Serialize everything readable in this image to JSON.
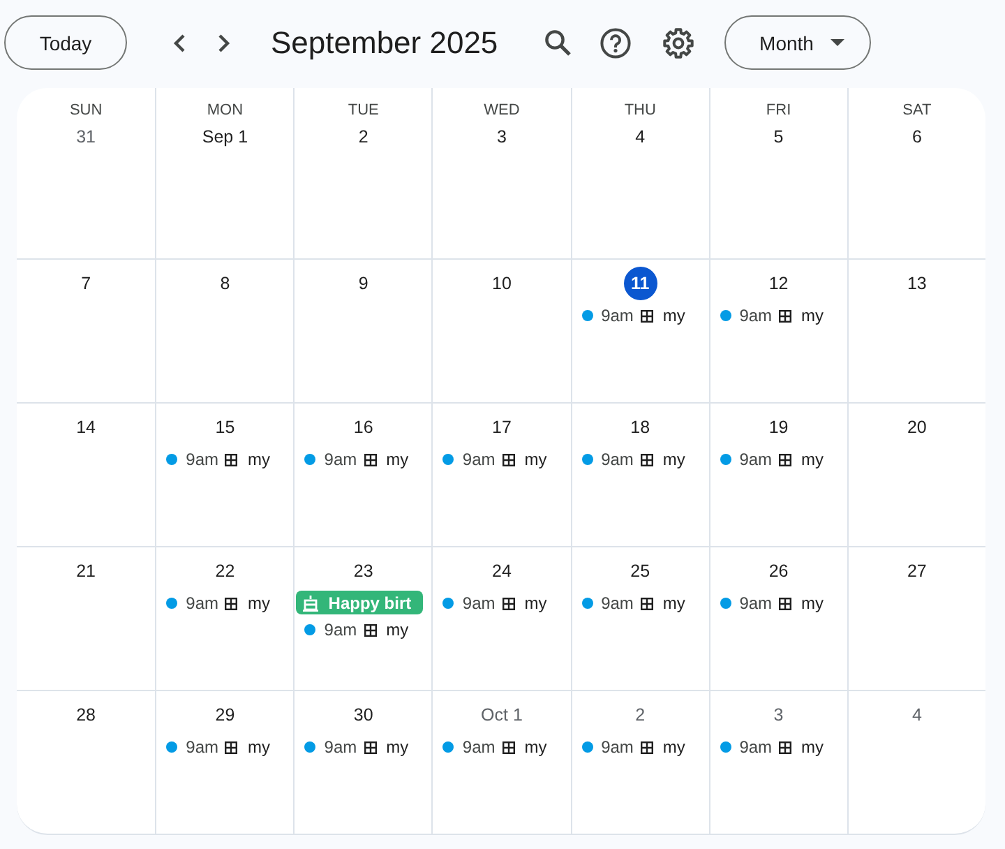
{
  "toolbar": {
    "today_button": "Today",
    "title": "September 2025",
    "view_dropdown": "Month"
  },
  "weekdays": [
    "SUN",
    "MON",
    "TUE",
    "WED",
    "THU",
    "FRI",
    "SAT"
  ],
  "weeks": [
    {
      "days": [
        {
          "date": "31",
          "current_month": false,
          "today": false
        },
        {
          "date": "Sep 1",
          "current_month": true,
          "today": false
        },
        {
          "date": "2",
          "current_month": true,
          "today": false
        },
        {
          "date": "3",
          "current_month": true,
          "today": false
        },
        {
          "date": "4",
          "current_month": true,
          "today": false
        },
        {
          "date": "5",
          "current_month": true,
          "today": false
        },
        {
          "date": "6",
          "current_month": true,
          "today": false
        }
      ]
    },
    {
      "days": [
        {
          "date": "7",
          "current_month": true,
          "today": false
        },
        {
          "date": "8",
          "current_month": true,
          "today": false
        },
        {
          "date": "9",
          "current_month": true,
          "today": false
        },
        {
          "date": "10",
          "current_month": true,
          "today": false
        },
        {
          "date": "11",
          "current_month": true,
          "today": true,
          "events": [
            {
              "kind": "timed",
              "time": "9am",
              "title": "my",
              "color": "#039be5"
            }
          ]
        },
        {
          "date": "12",
          "current_month": true,
          "today": false,
          "events": [
            {
              "kind": "timed",
              "time": "9am",
              "title": "my",
              "color": "#039be5"
            }
          ]
        },
        {
          "date": "13",
          "current_month": true,
          "today": false
        }
      ]
    },
    {
      "days": [
        {
          "date": "14",
          "current_month": true,
          "today": false
        },
        {
          "date": "15",
          "current_month": true,
          "today": false,
          "events": [
            {
              "kind": "timed",
              "time": "9am",
              "title": "my",
              "color": "#039be5"
            }
          ]
        },
        {
          "date": "16",
          "current_month": true,
          "today": false,
          "events": [
            {
              "kind": "timed",
              "time": "9am",
              "title": "my",
              "color": "#039be5"
            }
          ]
        },
        {
          "date": "17",
          "current_month": true,
          "today": false,
          "events": [
            {
              "kind": "timed",
              "time": "9am",
              "title": "my",
              "color": "#039be5"
            }
          ]
        },
        {
          "date": "18",
          "current_month": true,
          "today": false,
          "events": [
            {
              "kind": "timed",
              "time": "9am",
              "title": "my",
              "color": "#039be5"
            }
          ]
        },
        {
          "date": "19",
          "current_month": true,
          "today": false,
          "events": [
            {
              "kind": "timed",
              "time": "9am",
              "title": "my",
              "color": "#039be5"
            }
          ]
        },
        {
          "date": "20",
          "current_month": true,
          "today": false
        }
      ]
    },
    {
      "days": [
        {
          "date": "21",
          "current_month": true,
          "today": false
        },
        {
          "date": "22",
          "current_month": true,
          "today": false,
          "events": [
            {
              "kind": "timed",
              "time": "9am",
              "title": "my",
              "color": "#039be5"
            }
          ]
        },
        {
          "date": "23",
          "current_month": true,
          "today": false,
          "events": [
            {
              "kind": "all_day",
              "title": "Happy birt",
              "color": "#33b679"
            },
            {
              "kind": "timed",
              "time": "9am",
              "title": "my",
              "color": "#039be5"
            }
          ]
        },
        {
          "date": "24",
          "current_month": true,
          "today": false,
          "events": [
            {
              "kind": "timed",
              "time": "9am",
              "title": "my",
              "color": "#039be5"
            }
          ]
        },
        {
          "date": "25",
          "current_month": true,
          "today": false,
          "events": [
            {
              "kind": "timed",
              "time": "9am",
              "title": "my",
              "color": "#039be5"
            }
          ]
        },
        {
          "date": "26",
          "current_month": true,
          "today": false,
          "events": [
            {
              "kind": "timed",
              "time": "9am",
              "title": "my",
              "color": "#039be5"
            }
          ]
        },
        {
          "date": "27",
          "current_month": true,
          "today": false
        }
      ]
    },
    {
      "days": [
        {
          "date": "28",
          "current_month": true,
          "today": false
        },
        {
          "date": "29",
          "current_month": true,
          "today": false,
          "events": [
            {
              "kind": "timed",
              "time": "9am",
              "title": "my",
              "color": "#039be5"
            }
          ]
        },
        {
          "date": "30",
          "current_month": true,
          "today": false,
          "events": [
            {
              "kind": "timed",
              "time": "9am",
              "title": "my",
              "color": "#039be5"
            }
          ]
        },
        {
          "date": "Oct 1",
          "current_month": false,
          "today": false,
          "events": [
            {
              "kind": "timed",
              "time": "9am",
              "title": "my",
              "color": "#039be5"
            }
          ]
        },
        {
          "date": "2",
          "current_month": false,
          "today": false,
          "events": [
            {
              "kind": "timed",
              "time": "9am",
              "title": "my",
              "color": "#039be5"
            }
          ]
        },
        {
          "date": "3",
          "current_month": false,
          "today": false,
          "events": [
            {
              "kind": "timed",
              "time": "9am",
              "title": "my",
              "color": "#039be5"
            }
          ]
        },
        {
          "date": "4",
          "current_month": false,
          "today": false
        }
      ]
    }
  ]
}
